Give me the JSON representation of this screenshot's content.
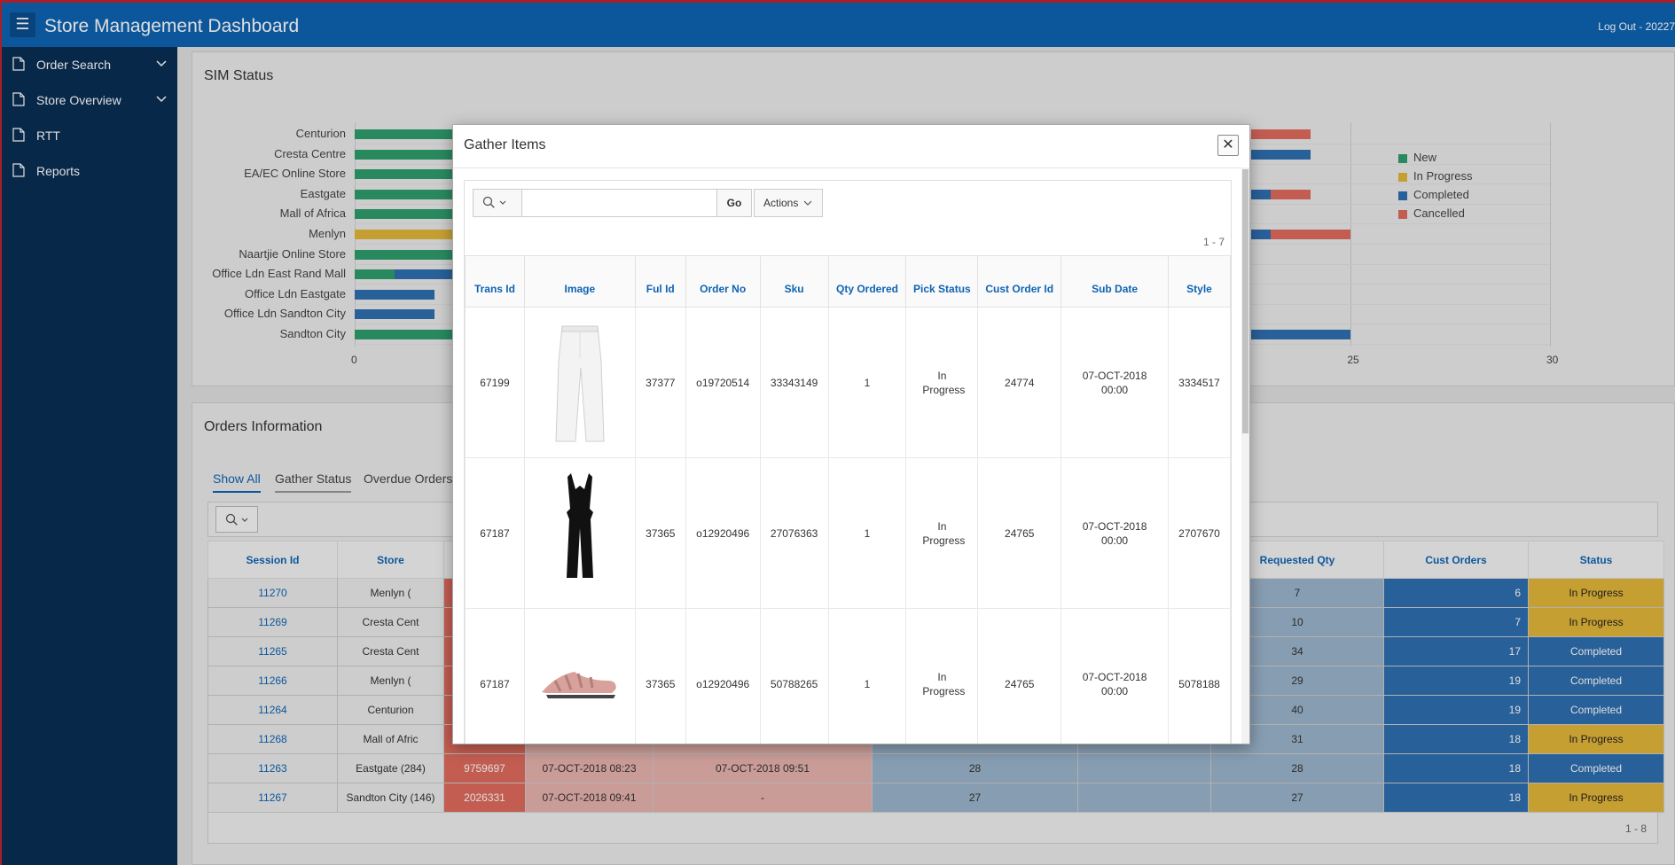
{
  "header": {
    "menu_icon": "hamburger-icon",
    "title": "Store Management Dashboard",
    "logout": "Log Out - 20227"
  },
  "sidebar": {
    "items": [
      {
        "label": "Order Search",
        "has_chevron": true
      },
      {
        "label": "Store Overview",
        "has_chevron": true
      },
      {
        "label": "RTT",
        "has_chevron": false
      },
      {
        "label": "Reports",
        "has_chevron": false
      }
    ]
  },
  "sim_status": {
    "title": "SIM Status",
    "chart_data": {
      "type": "bar",
      "orientation": "horizontal",
      "stacked": true,
      "categories": [
        "Centurion",
        "Cresta Centre",
        "EA/EC Online Store",
        "Eastgate",
        "Mall of Africa",
        "Menlyn",
        "Naartjie Online Store",
        "Office Ldn East Rand Mall",
        "Office Ldn Eastgate",
        "Office Ldn Sandton City",
        "Sandton City"
      ],
      "x_ticks": [
        "0",
        "25",
        "30"
      ],
      "xlim": [
        0,
        30
      ],
      "series": [
        {
          "name": "New",
          "color": "#2e9e6e",
          "values": [
            5,
            5,
            5,
            5,
            5,
            0,
            5,
            1,
            0,
            0,
            5
          ]
        },
        {
          "name": "In Progress",
          "color": "#e4b73b",
          "values": [
            0,
            5,
            0,
            0,
            0,
            5,
            0,
            0,
            0,
            0,
            0
          ]
        },
        {
          "name": "Completed",
          "color": "#2f6fb0",
          "values": [
            0,
            0,
            0,
            0,
            0,
            0,
            0,
            1.5,
            2,
            2,
            0
          ]
        },
        {
          "name": "Cancelled",
          "color": "#e06b5d",
          "values": [
            0,
            0,
            0,
            0,
            0,
            0,
            0,
            0,
            0,
            0,
            0
          ]
        }
      ],
      "visible_right_segments": [
        {
          "row": 0,
          "start": 22.5,
          "end": 24,
          "color": "#e06b5d"
        },
        {
          "row": 1,
          "start": 22.5,
          "end": 24,
          "color": "#2f6fb0"
        },
        {
          "row": 3,
          "start": 22.5,
          "end": 23,
          "color": "#2f6fb0"
        },
        {
          "row": 3,
          "start": 23,
          "end": 24,
          "color": "#e06b5d"
        },
        {
          "row": 5,
          "start": 22.5,
          "end": 23,
          "color": "#2f6fb0"
        },
        {
          "row": 5,
          "start": 23,
          "end": 25,
          "color": "#e06b5d"
        },
        {
          "row": 10,
          "start": 22.5,
          "end": 25,
          "color": "#2f6fb0"
        }
      ],
      "legend_position": "right"
    }
  },
  "orders_info": {
    "title": "Orders Information",
    "tabs": [
      "Show All",
      "Gather Status",
      "Overdue Orders"
    ],
    "columns": [
      "Session Id",
      "Store",
      "Requested Qty",
      "Cust Orders",
      "Status"
    ],
    "rows": [
      {
        "session": "11270",
        "store": "Menlyn (",
        "req": "7",
        "cust": "6",
        "status": "In Progress"
      },
      {
        "session": "11269",
        "store": "Cresta Cent",
        "req": "10",
        "cust": "7",
        "status": "In Progress"
      },
      {
        "session": "11265",
        "store": "Cresta Cent",
        "req": "34",
        "cust": "17",
        "status": "Completed"
      },
      {
        "session": "11266",
        "store": "Menlyn (",
        "req": "29",
        "cust": "19",
        "status": "Completed"
      },
      {
        "session": "11264",
        "store": "Centurion",
        "req": "40",
        "cust": "19",
        "status": "Completed"
      },
      {
        "session": "11268",
        "store": "Mall of Afric",
        "req": "31",
        "cust": "18",
        "status": "In Progress"
      },
      {
        "session": "11263",
        "store": "Eastgate (284)",
        "order": "9759697",
        "start": "07-OCT-2018 08:23",
        "end": "07-OCT-2018 09:51",
        "qty": "28",
        "req": "28",
        "cust": "18",
        "status": "Completed"
      },
      {
        "session": "11267",
        "store": "Sandton City (146)",
        "order": "2026331",
        "start": "07-OCT-2018 09:41",
        "end": "-",
        "qty": "27",
        "req": "27",
        "cust": "18",
        "status": "In Progress"
      }
    ],
    "pagination": "1 - 8"
  },
  "dialog": {
    "title": "Gather Items",
    "close_icon": "close-icon",
    "search": {
      "placeholder": "",
      "go": "Go",
      "actions": "Actions"
    },
    "pagination": "1 - 7",
    "columns": [
      "Trans Id",
      "Image",
      "Ful Id",
      "Order No",
      "Sku",
      "Qty Ordered",
      "Pick Status",
      "Cust Order Id",
      "Sub Date",
      "Style"
    ],
    "rows": [
      {
        "trans": "67199",
        "image": "white-trousers",
        "ful": "37377",
        "order": "o19720514",
        "sku": "33343149",
        "qty": "1",
        "pick": "In Progress",
        "cust": "24774",
        "date": "07-OCT-2018 00:00",
        "style": "3334517"
      },
      {
        "trans": "67187",
        "image": "black-jumpsuit",
        "ful": "37365",
        "order": "o12920496",
        "sku": "27076363",
        "qty": "1",
        "pick": "In Progress",
        "cust": "24765",
        "date": "07-OCT-2018 00:00",
        "style": "2707670"
      },
      {
        "trans": "67187",
        "image": "pink-sandal",
        "ful": "37365",
        "order": "o12920496",
        "sku": "50788265",
        "qty": "1",
        "pick": "In Progress",
        "cust": "24765",
        "date": "07-OCT-2018 00:00",
        "style": "5078188"
      }
    ]
  }
}
